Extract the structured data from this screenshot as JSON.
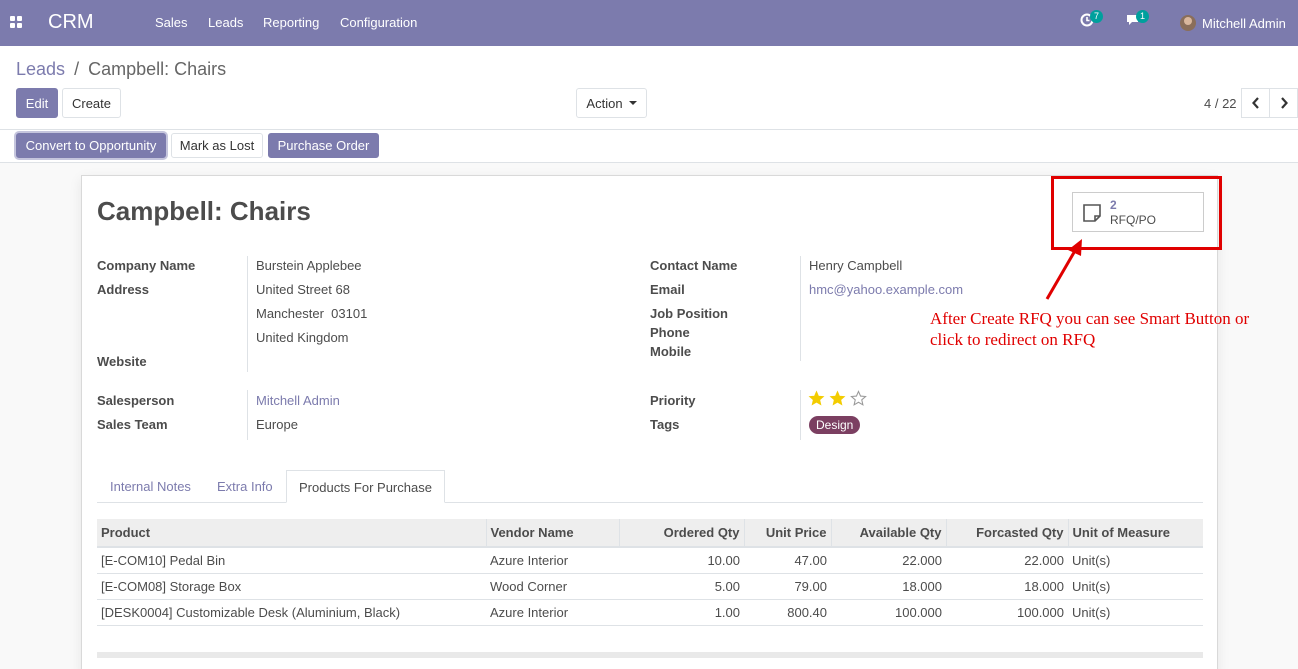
{
  "nav": {
    "brand": "CRM",
    "menu": [
      "Sales",
      "Leads",
      "Reporting",
      "Configuration"
    ],
    "activity_count": "7",
    "message_count": "1",
    "user": "Mitchell Admin"
  },
  "breadcrumb": {
    "parent": "Leads",
    "separator": "/",
    "current": "Campbell: Chairs"
  },
  "buttons": {
    "edit": "Edit",
    "create": "Create",
    "action": "Action"
  },
  "pager": {
    "text": "4 / 22"
  },
  "statusbar": {
    "convert": "Convert to Opportunity",
    "lost": "Mark as Lost",
    "purchase": "Purchase Order"
  },
  "record": {
    "title": "Campbell: Chairs",
    "smart_button": {
      "count": "2",
      "label": "RFQ/PO"
    },
    "left": {
      "company_label": "Company Name",
      "company": "Burstein Applebee",
      "address_label": "Address",
      "street": "United Street 68",
      "city_zip": "Manchester  03101",
      "country": "United Kingdom",
      "website_label": "Website",
      "salesperson_label": "Salesperson",
      "salesperson": "Mitchell Admin",
      "team_label": "Sales Team",
      "team": "Europe"
    },
    "right": {
      "contact_label": "Contact Name",
      "contact": "Henry Campbell",
      "email_label": "Email",
      "email": "hmc@yahoo.example.com",
      "job_label": "Job Position",
      "phone_label": "Phone",
      "mobile_label": "Mobile",
      "priority_label": "Priority",
      "priority": 2,
      "priority_max": 3,
      "tags_label": "Tags",
      "tag": "Design"
    }
  },
  "annotation": {
    "line1": "After Create RFQ you can see Smart Button or",
    "line2": "click to redirect on RFQ"
  },
  "tabs": [
    "Internal Notes",
    "Extra Info",
    "Products For Purchase"
  ],
  "table": {
    "headers": [
      "Product",
      "Vendor Name",
      "Ordered Qty",
      "Unit Price",
      "Available Qty",
      "Forcasted Qty",
      "Unit of Measure"
    ],
    "rows": [
      [
        "[E-COM10] Pedal Bin",
        "Azure Interior",
        "10.00",
        "47.00",
        "22.000",
        "22.000",
        "Unit(s)"
      ],
      [
        "[E-COM08] Storage Box",
        "Wood Corner",
        "5.00",
        "79.00",
        "18.000",
        "18.000",
        "Unit(s)"
      ],
      [
        "[DESK0004] Customizable Desk (Aluminium, Black)",
        "Azure Interior",
        "1.00",
        "800.40",
        "100.000",
        "100.000",
        "Unit(s)"
      ]
    ]
  },
  "colors": {
    "primary": "#7c7bad",
    "tag": "#7b3f61",
    "annotation": "#e00000",
    "star": "#f3cc00"
  }
}
